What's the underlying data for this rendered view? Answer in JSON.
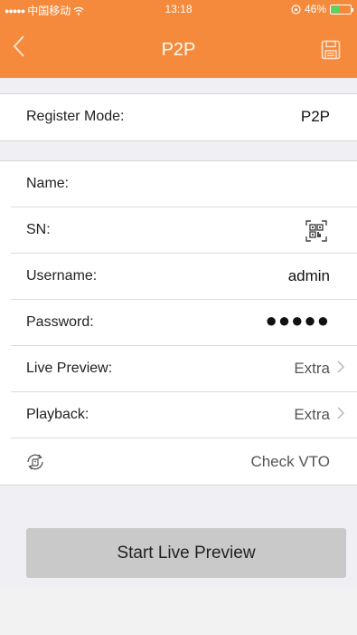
{
  "status": {
    "carrier": "中国移动",
    "time": "13:18",
    "battery_pct": "46%",
    "battery_level": 0.46
  },
  "nav": {
    "title": "P2P",
    "back_icon": "chevron-left-icon",
    "save_icon": "floppy-save-icon"
  },
  "register": {
    "label": "Register Mode:",
    "value": "P2P"
  },
  "fields": {
    "name_label": "Name:",
    "sn_label": "SN:",
    "sn_icon": "qr-scan-icon",
    "username_label": "Username:",
    "username_value": "admin",
    "password_label": "Password:",
    "password_mask": "●●●●●",
    "live_preview_label": "Live Preview:",
    "live_preview_value": "Extra",
    "playback_label": "Playback:",
    "playback_value": "Extra",
    "check_vto_label": "Check VTO",
    "check_vto_icon": "vto-refresh-icon"
  },
  "action": {
    "start_label": "Start Live Preview"
  },
  "colors": {
    "header": "#f58a3c",
    "background": "#efeff4",
    "button": "#c9c9c9"
  }
}
